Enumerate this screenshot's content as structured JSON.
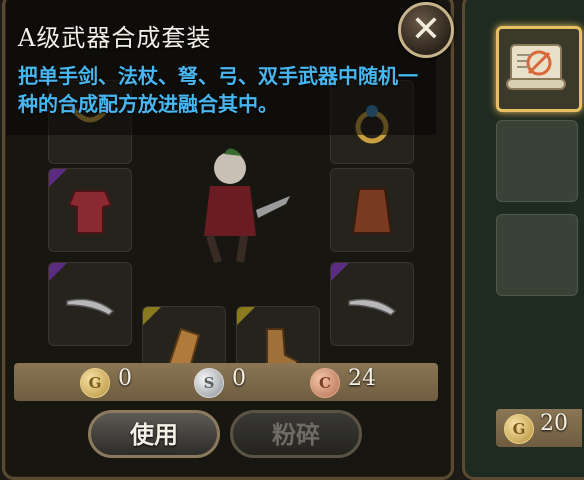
{
  "tooltip": {
    "title": "A级武器合成套装",
    "description": "把单手剑、法杖、弩、弓、双手武器中随机一种的合成配方放进融合其中。"
  },
  "close_label": "✕",
  "currency": {
    "gold_symbol": "G",
    "gold": "0",
    "silver_symbol": "S",
    "silver": "0",
    "copper_symbol": "C",
    "copper": "24"
  },
  "buttons": {
    "use": "使用",
    "crush": "粉碎"
  },
  "side_panel": {
    "coin_symbol": "G",
    "gold": "20"
  },
  "colors": {
    "accent_gold": "#e6c061",
    "desc_blue": "#48b6f0",
    "frame": "#5a4a32"
  }
}
